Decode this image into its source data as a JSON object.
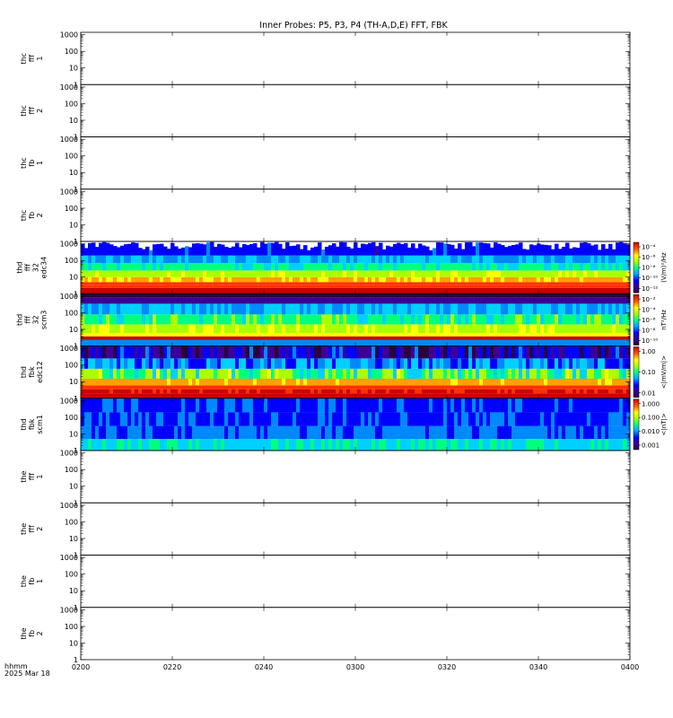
{
  "title": "Inner Probes: P5, P3, P4 (TH-A,D,E) FFT, FBK",
  "footer": {
    "line1": "hhmm",
    "line2": "2025 Mar 18"
  },
  "chart_data": {
    "type": "heatmap",
    "x": {
      "ticks": [
        "0200",
        "0220",
        "0240",
        "0300",
        "0320",
        "0340",
        "0400"
      ]
    },
    "y": {
      "scale": "log",
      "range": [
        1,
        1000
      ],
      "ticks": [
        "1",
        "10",
        "100",
        "1000"
      ]
    },
    "panels": [
      {
        "label": [
          "thc",
          "fff",
          "1"
        ],
        "has_data": false
      },
      {
        "label": [
          "thc",
          "fff",
          "2"
        ],
        "has_data": false
      },
      {
        "label": [
          "thc",
          "fb",
          "1"
        ],
        "has_data": false
      },
      {
        "label": [
          "thc",
          "fb",
          "2"
        ],
        "has_data": false
      },
      {
        "label": [
          "thd",
          "fff",
          "32",
          "edc34"
        ],
        "has_data": true,
        "style": "edc",
        "colorbar": {
          "ticks": [
            "10⁻⁴",
            "10⁻⁶",
            "10⁻⁸",
            "10⁻¹⁰",
            "10⁻¹²"
          ],
          "unit": "(V/m)²/Hz"
        }
      },
      {
        "label": [
          "thd",
          "fff",
          "32",
          "scm3"
        ],
        "has_data": true,
        "style": "scm",
        "colorbar": {
          "ticks": [
            "10⁻²",
            "10⁻⁴",
            "10⁻⁶",
            "10⁻⁸",
            "10⁻¹⁰"
          ],
          "unit": "nT²/Hz"
        }
      },
      {
        "label": [
          "thd",
          "fbk",
          "edc12"
        ],
        "has_data": true,
        "style": "fbk_e",
        "colorbar": {
          "ticks": [
            "1.00",
            "0.10",
            "0.01"
          ],
          "unit": "<|mV/m|>"
        }
      },
      {
        "label": [
          "thd",
          "fbk",
          "scm1"
        ],
        "has_data": true,
        "style": "fbk_b",
        "colorbar": {
          "ticks": [
            "1.000",
            "0.100",
            "0.010",
            "0.001"
          ],
          "unit": "<|nT|>"
        }
      },
      {
        "label": [
          "the",
          "fff",
          "1"
        ],
        "has_data": false
      },
      {
        "label": [
          "the",
          "fff",
          "2"
        ],
        "has_data": false
      },
      {
        "label": [
          "the",
          "fb",
          "1"
        ],
        "has_data": false
      },
      {
        "label": [
          "the",
          "fb",
          "2"
        ],
        "has_data": false
      }
    ]
  }
}
